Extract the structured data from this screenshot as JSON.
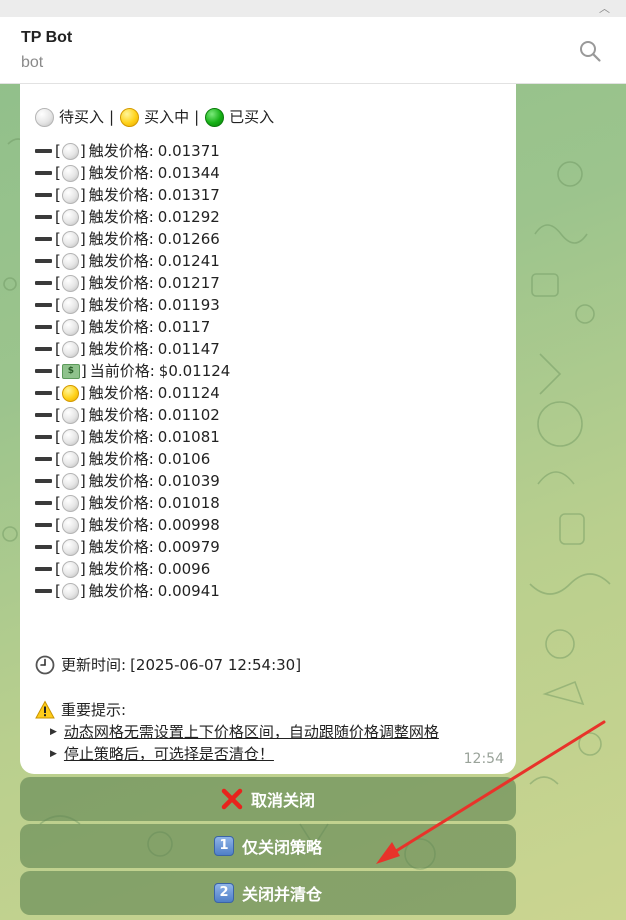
{
  "chat": {
    "title": "TP Bot",
    "subtitle": "bot"
  },
  "legend": {
    "pending": "待买入",
    "buying": "买入中",
    "bought": "已买入",
    "separator": "|"
  },
  "levels": [
    {
      "status": "pending",
      "label": "触发价格:",
      "price": "0.01371"
    },
    {
      "status": "pending",
      "label": "触发价格:",
      "price": "0.01344"
    },
    {
      "status": "pending",
      "label": "触发价格:",
      "price": "0.01317"
    },
    {
      "status": "pending",
      "label": "触发价格:",
      "price": "0.01292"
    },
    {
      "status": "pending",
      "label": "触发价格:",
      "price": "0.01266"
    },
    {
      "status": "pending",
      "label": "触发价格:",
      "price": "0.01241"
    },
    {
      "status": "pending",
      "label": "触发价格:",
      "price": "0.01217"
    },
    {
      "status": "pending",
      "label": "触发价格:",
      "price": "0.01193"
    },
    {
      "status": "pending",
      "label": "触发价格:",
      "price": "0.0117"
    },
    {
      "status": "pending",
      "label": "触发价格:",
      "price": "0.01147"
    },
    {
      "status": "current",
      "label": "当前价格:",
      "price": "$0.01124"
    },
    {
      "status": "buying",
      "label": "触发价格:",
      "price": "0.01124"
    },
    {
      "status": "pending",
      "label": "触发价格:",
      "price": "0.01102"
    },
    {
      "status": "pending",
      "label": "触发价格:",
      "price": "0.01081"
    },
    {
      "status": "pending",
      "label": "触发价格:",
      "price": "0.0106"
    },
    {
      "status": "pending",
      "label": "触发价格:",
      "price": "0.01039"
    },
    {
      "status": "pending",
      "label": "触发价格:",
      "price": "0.01018"
    },
    {
      "status": "pending",
      "label": "触发价格:",
      "price": "0.00998"
    },
    {
      "status": "pending",
      "label": "触发价格:",
      "price": "0.00979"
    },
    {
      "status": "pending",
      "label": "触发价格:",
      "price": "0.0096"
    },
    {
      "status": "pending",
      "label": "触发价格:",
      "price": "0.00941"
    }
  ],
  "update": {
    "label": "更新时间:",
    "value": "[2025-06-07 12:54:30]"
  },
  "notice": {
    "title": "重要提示:",
    "tips": [
      "动态网格无需设置上下价格区间，自动跟随价格调整网格",
      "停止策略后，可选择是否清仓！"
    ]
  },
  "message_time": "12:54",
  "buttons": {
    "cancel": "取消关闭",
    "close_only": "仅关闭策略",
    "close_and_clear": "关闭并清仓",
    "num1": "1",
    "num2": "2"
  },
  "colors": {
    "accent_green": "#0b7d0b",
    "arrow_red": "#e8332a",
    "button_bg": "#6a8a58"
  },
  "icons": [
    "search-icon",
    "white-circle-icon",
    "yellow-circle-icon",
    "green-circle-icon",
    "money-icon",
    "clock-icon",
    "warning-icon",
    "cross-mark-icon",
    "keycap-1-icon",
    "keycap-2-icon"
  ]
}
